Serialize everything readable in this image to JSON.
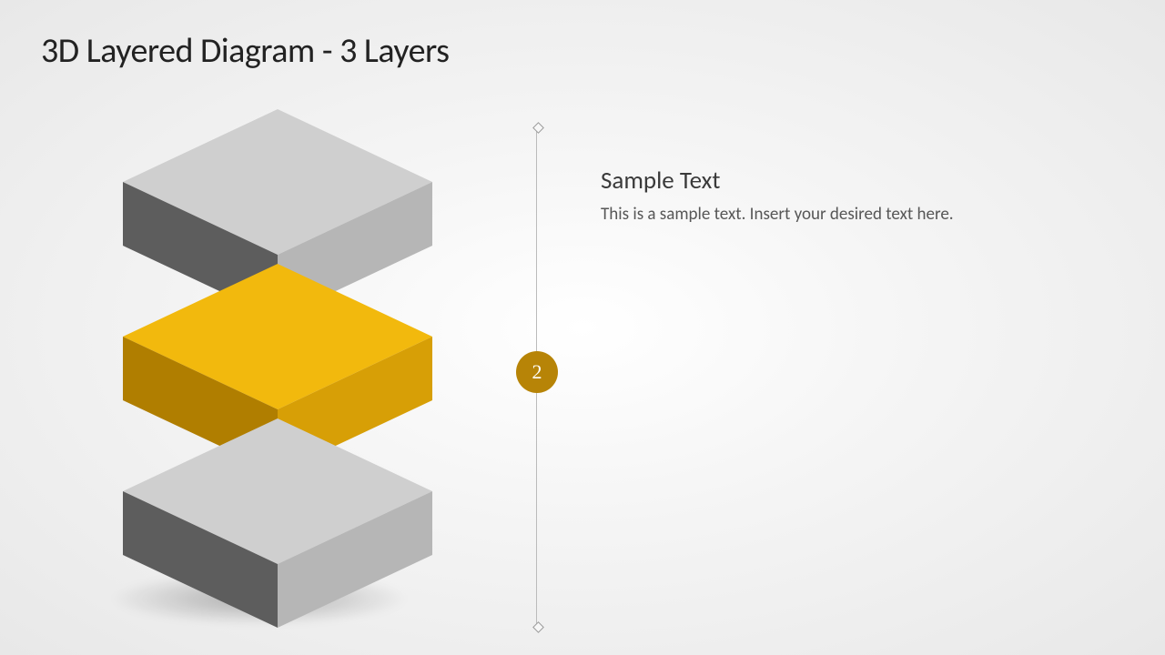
{
  "title": "3D Layered Diagram - 3 Layers",
  "badge_number": "2",
  "callout": {
    "heading": "Sample Text",
    "body": "This is a sample text. Insert your desired text here."
  },
  "layers": [
    {
      "id": 1,
      "role": "neutral",
      "top": "#cfcfcf",
      "left": "#5d5d5d",
      "right": "#b6b6b6"
    },
    {
      "id": 2,
      "role": "highlight",
      "top": "#f2b90d",
      "left": "#b07e00",
      "right": "#d79f06"
    },
    {
      "id": 3,
      "role": "neutral",
      "top": "#cfcfcf",
      "left": "#5d5d5d",
      "right": "#b6b6b6"
    }
  ],
  "colors": {
    "accent": "#b78407",
    "line": "#bbbbbb",
    "text": "#3a3a3a"
  }
}
